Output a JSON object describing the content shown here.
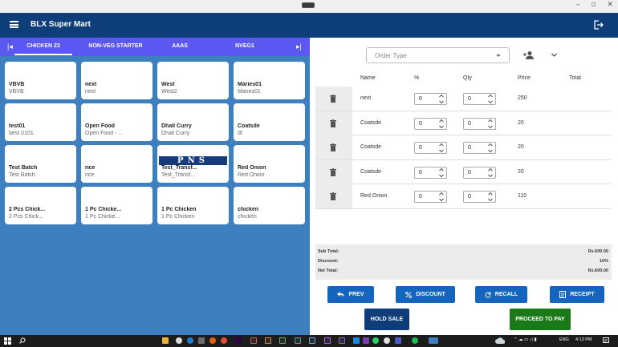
{
  "window": {
    "minimize": "–",
    "maximize": "▫",
    "close": "✕"
  },
  "app": {
    "title": "BLX Super Mart"
  },
  "tabs": [
    "CHICKEN 23",
    "NON-VEG STARTER",
    "AAAS",
    "NVEG1"
  ],
  "products": [
    {
      "name": "VBVB",
      "sub": "VBVB"
    },
    {
      "name": "next",
      "sub": "next"
    },
    {
      "name": "West",
      "sub": "West2"
    },
    {
      "name": "Maries01",
      "sub": "Maries01"
    },
    {
      "name": "test01",
      "sub": "best 0101"
    },
    {
      "name": "Open Food",
      "sub": "Open Food - ..."
    },
    {
      "name": "Dhall Curry",
      "sub": "Dhall Curry"
    },
    {
      "name": "Coatsde",
      "sub": "df"
    },
    {
      "name": "Test Batch",
      "sub": "Test Batch"
    },
    {
      "name": "rice",
      "sub": "rice"
    },
    {
      "name": "Test_Transf...",
      "sub": "Test_Transf...",
      "logo": "PNS"
    },
    {
      "name": "Red Onion",
      "sub": "Red Onion"
    },
    {
      "name": "2 Pcs Chick...",
      "sub": "2 Pcs Chick..."
    },
    {
      "name": "1 Pc Chicke...",
      "sub": "1 Pc Chicke..."
    },
    {
      "name": "1 Pc Chicken",
      "sub": "1 Pc Chicken"
    },
    {
      "name": "chicken",
      "sub": "chicken"
    }
  ],
  "order": {
    "order_type_placeholder": "Order Type",
    "columns": {
      "name": "Name",
      "percent": "%",
      "qty": "Qty",
      "price": "Price",
      "total": "Total"
    },
    "items": [
      {
        "name": "next",
        "percent": "0",
        "qty": "0",
        "price": "250"
      },
      {
        "name": "Coatsde",
        "percent": "0",
        "qty": "0",
        "price": "20"
      },
      {
        "name": "Coatsde",
        "percent": "0",
        "qty": "0",
        "price": "20"
      },
      {
        "name": "Coatsde",
        "percent": "0",
        "qty": "0",
        "price": "20"
      },
      {
        "name": "Red Onion",
        "percent": "0",
        "qty": "0",
        "price": "110"
      }
    ],
    "totals": {
      "sub_total_label": "Sub Total:",
      "sub_total": "Rs.600.00",
      "discount_label": "Discount:",
      "discount": "10%",
      "net_total_label": "Net Total:",
      "net_total": "Rs.600.00"
    }
  },
  "buttons": {
    "prev": "PREV",
    "discount": "DISCOUNT",
    "recall": "RECALL",
    "receipt": "RECEIPT",
    "hold_sale": "HOLD SALE",
    "proceed": "PROCEED TO PAY"
  },
  "colors": {
    "appbar": "#0d3e7a",
    "tabbar": "#5b57f0",
    "left_bg": "#3e7fc0",
    "btn_blue": "#1565c0",
    "hold": "#0d3e7a",
    "proceed": "#1a7a1a"
  },
  "taskbar": {
    "lang": "ENG",
    "time": "4:13 PM"
  }
}
